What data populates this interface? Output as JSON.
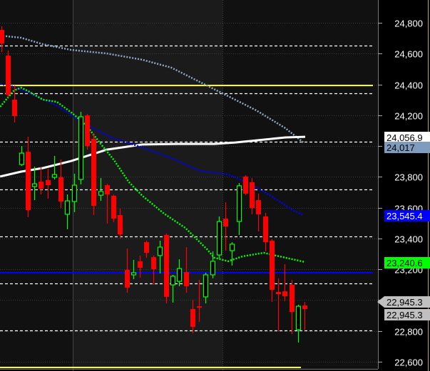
{
  "chart_data": {
    "type": "candlestick",
    "title": "",
    "ylim": [
      22540,
      24950
    ],
    "y_ticks": [
      24800,
      24600,
      24400,
      24200,
      24000,
      23800,
      23600,
      23400,
      23200,
      23000,
      22800,
      22600
    ],
    "y_tick_labels": [
      "24,800",
      "24,600",
      "24,400",
      "24,200",
      "24,000",
      "23,800",
      "23,600",
      "23,400",
      "23,200",
      "23,000",
      "22,800",
      "22,600"
    ],
    "colors": {
      "up": "#00ff00",
      "down": "#ff0000",
      "background_dark": "#111111",
      "background_light": "#1b1b1b"
    },
    "candles": [
      [
        24754,
        24777,
        24610,
        24666
      ],
      [
        24587,
        24620,
        24315,
        24333
      ],
      [
        24301,
        24393,
        24153,
        24195
      ],
      [
        23880,
        24000,
        23871,
        23954
      ],
      [
        23963,
        24060,
        23538,
        23584
      ],
      [
        23737,
        23866,
        23649,
        23755
      ],
      [
        23769,
        23866,
        23686,
        23723
      ],
      [
        23779,
        23852,
        23658,
        23746
      ],
      [
        23797,
        23936,
        23783,
        23815
      ],
      [
        23797,
        23913,
        23598,
        23640
      ],
      [
        23557,
        23686,
        23460,
        23644
      ],
      [
        23640,
        23820,
        23571,
        23746
      ],
      [
        23783,
        24222,
        23751,
        24190
      ],
      [
        24199,
        24208,
        23977,
        24000
      ],
      [
        24047,
        24084,
        23552,
        23612
      ],
      [
        23681,
        23792,
        23644,
        23705
      ],
      [
        23746,
        23755,
        23497,
        23686
      ],
      [
        23677,
        23686,
        23506,
        23529
      ],
      [
        23552,
        23594,
        23400,
        23427
      ],
      [
        23196,
        23335,
        23048,
        23081
      ],
      [
        23164,
        23261,
        23136,
        23178
      ],
      [
        23252,
        23289,
        23145,
        23210
      ],
      [
        23376,
        23386,
        23275,
        23307
      ],
      [
        23279,
        23289,
        23099,
        23201
      ],
      [
        23289,
        23386,
        23173,
        23344
      ],
      [
        23423,
        23432,
        22979,
        23021
      ],
      [
        23099,
        23164,
        22984,
        23155
      ],
      [
        23122,
        23265,
        23090,
        23205
      ],
      [
        23182,
        23344,
        23048,
        23090
      ],
      [
        22942,
        23002,
        22785,
        22826
      ],
      [
        22960,
        23131,
        22859,
        22951
      ],
      [
        23021,
        23178,
        22979,
        23164
      ],
      [
        23164,
        23316,
        23141,
        23252
      ],
      [
        23293,
        23543,
        23270,
        23510
      ],
      [
        23529,
        23635,
        23321,
        23478
      ],
      [
        23321,
        23376,
        23224,
        23363
      ],
      [
        23510,
        23760,
        23423,
        23742
      ],
      [
        23802,
        23811,
        23681,
        23691
      ],
      [
        23765,
        23792,
        23557,
        23598
      ],
      [
        23649,
        23691,
        23446,
        23557
      ],
      [
        23543,
        23566,
        23316,
        23376
      ],
      [
        23386,
        23395,
        22988,
        23067
      ],
      [
        23053,
        23141,
        22799,
        23039
      ],
      [
        23057,
        23233,
        22993,
        23025
      ],
      [
        23099,
        23131,
        22780,
        22923
      ],
      [
        22808,
        22970,
        22725,
        22960
      ],
      [
        22965,
        22988,
        22808,
        22942
      ]
    ],
    "candle_format": [
      "open",
      "high",
      "low",
      "close"
    ],
    "moving_averages": [
      {
        "name": "ma-slow",
        "color": "#8fa8c8",
        "style": "dotted",
        "points": [
          [
            -0.2,
            24717
          ],
          [
            3,
            24703
          ],
          [
            6.3,
            24661
          ],
          [
            10.6,
            24624
          ],
          [
            16,
            24601
          ],
          [
            21.4,
            24560
          ],
          [
            25.8,
            24509
          ],
          [
            30.1,
            24416
          ],
          [
            34.4,
            24324
          ],
          [
            38.7,
            24231
          ],
          [
            43.1,
            24116
          ],
          [
            45.8,
            24024
          ]
        ]
      },
      {
        "name": "ma-white",
        "color": "#ffffff",
        "style": "solid",
        "points": [
          [
            -0.2,
            23802
          ],
          [
            3,
            23834
          ],
          [
            6.3,
            23857
          ],
          [
            10.6,
            23903
          ],
          [
            16,
            23977
          ],
          [
            21.4,
            24010
          ],
          [
            26.8,
            24014
          ],
          [
            32.3,
            24014
          ],
          [
            35.5,
            24023
          ],
          [
            38.7,
            24037
          ],
          [
            43.1,
            24056
          ],
          [
            46.1,
            24060
          ]
        ]
      },
      {
        "name": "ma-blue",
        "color": "#0000ff",
        "style": "dotted",
        "points": [
          [
            -0.2,
            24403
          ],
          [
            1.9,
            24384
          ],
          [
            4.1,
            24347
          ],
          [
            8.4,
            24264
          ],
          [
            12.8,
            24139
          ],
          [
            17.1,
            24047
          ],
          [
            21.4,
            23991
          ],
          [
            25.8,
            23922
          ],
          [
            30.1,
            23839
          ],
          [
            34.4,
            23816
          ],
          [
            37.7,
            23755
          ],
          [
            40.9,
            23677
          ],
          [
            44.2,
            23584
          ],
          [
            45.8,
            23552
          ]
        ]
      },
      {
        "name": "ma-green",
        "color": "#00ff00",
        "style": "dotted",
        "points": [
          [
            -0.2,
            24255
          ],
          [
            1.9,
            24361
          ],
          [
            3,
            24379
          ],
          [
            4.1,
            24356
          ],
          [
            6.3,
            24301
          ],
          [
            8.4,
            24287
          ],
          [
            10.6,
            24218
          ],
          [
            12.8,
            24139
          ],
          [
            14.9,
            24023
          ],
          [
            17.1,
            23908
          ],
          [
            19.3,
            23769
          ],
          [
            21.4,
            23677
          ],
          [
            24.7,
            23561
          ],
          [
            27.9,
            23469
          ],
          [
            31.2,
            23330
          ],
          [
            32.3,
            23275
          ],
          [
            34.4,
            23252
          ],
          [
            36.6,
            23284
          ],
          [
            39.8,
            23307
          ],
          [
            43.1,
            23275
          ],
          [
            46.1,
            23247
          ]
        ]
      }
    ],
    "horizontal_lines": [
      {
        "price": 24393,
        "color": "#ffff00",
        "style": "solid"
      },
      {
        "price": 22563,
        "color": "#ffff00",
        "style": "solid"
      },
      {
        "price": 23178,
        "color": "#0000ff",
        "style": "solid"
      },
      {
        "price": 24652,
        "color": "#ffffff",
        "style": "dashed"
      },
      {
        "price": 24342,
        "color": "#ffffff",
        "style": "dashed"
      },
      {
        "price": 24028,
        "color": "#ffffff",
        "style": "dashed"
      },
      {
        "price": 23718,
        "color": "#ffffff",
        "style": "dashed"
      },
      {
        "price": 23413,
        "color": "#ffffff",
        "style": "dashed"
      },
      {
        "price": 23108,
        "color": "#ffffff",
        "style": "dashed"
      },
      {
        "price": 22803,
        "color": "#ffffff",
        "style": "dashed"
      }
    ],
    "price_labels": [
      {
        "text": "24,056.9",
        "price": 24056.9,
        "bg": "#ffffff",
        "fg": "#000000"
      },
      {
        "text": "24,017",
        "price": 23990,
        "bg": "#7f9bbd",
        "fg": "#000000"
      },
      {
        "text": "23,545.4",
        "price": 23545.4,
        "bg": "#0000ff",
        "fg": "#ffffff"
      },
      {
        "text": "23,240.6",
        "price": 23240.6,
        "bg": "#00ff00",
        "fg": "#000000"
      },
      {
        "text": "22,945.3",
        "price": 22990,
        "bg": "#c0c0c0",
        "fg": "#000000",
        "arrow": true
      },
      {
        "text": "22,945.3",
        "price": 22905,
        "bg": "#c0c0c0",
        "fg": "#000000"
      }
    ]
  }
}
